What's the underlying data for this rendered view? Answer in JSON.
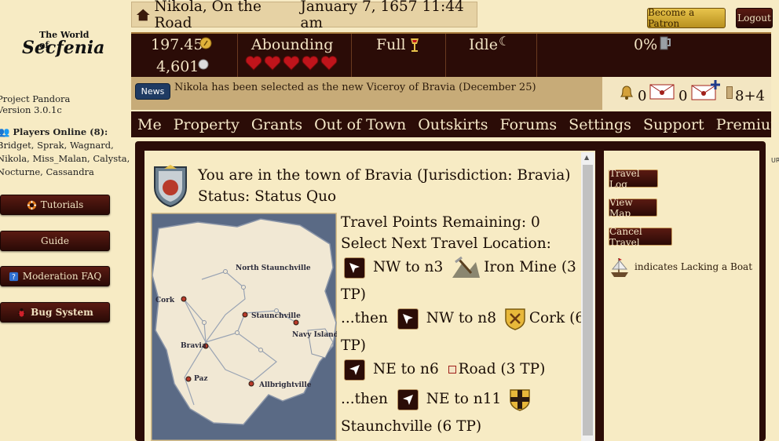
{
  "logo": {
    "line1": "The World of",
    "line2": "Secfenia"
  },
  "sidebar": {
    "project": "Project Pandora",
    "version": "Version 3.0.1c",
    "players_label": "Players Online (8):",
    "players_line1": "Bridget, Sprak, Wagnard,",
    "players_line2": "Nikola, Miss_Malan, Calysta,",
    "players_line3": "Nocturne, Cassandra",
    "buttons": [
      {
        "label": "Tutorials",
        "icon": "lifebuoy-icon"
      },
      {
        "label": "Guide",
        "icon": ""
      },
      {
        "label": "Moderation FAQ",
        "icon": "question-icon"
      },
      {
        "label": "Bug System",
        "icon": "bug-icon"
      }
    ]
  },
  "header": {
    "location": "Nikola, On the Road",
    "date": "January 7, 1657 11:44 am",
    "patron": "Become a Patron",
    "logout": "Logout"
  },
  "stats": {
    "money": "197.45",
    "silver": "4,601",
    "health_label": "Abounding",
    "hearts": 5,
    "food": "Full",
    "activity": "Idle",
    "drink": "0%"
  },
  "news": {
    "badge": "News",
    "text": "Nikola has been selected as the new Viceroy of Bravia (December 25)"
  },
  "notifications": {
    "bell": "0",
    "mail": "0",
    "new_mail": "",
    "counter": "8+4"
  },
  "nav": [
    "Me",
    "Property",
    "Grants",
    "Out of Town",
    "Outskirts",
    "Forums",
    "Settings",
    "Support",
    "Premium"
  ],
  "main": {
    "town_line": "You are in the town of Bravia (Jurisdiction: Bravia)",
    "status_line": "Status: Status Quo",
    "travel_points": "Travel Points Remaining: 0",
    "select_next": "Select Next Travel Location:",
    "options": [
      {
        "prefix": "",
        "dir": "NW to n3",
        "dest": "Iron Mine (3",
        "wrap": "TP)"
      },
      {
        "prefix": "...then",
        "dir": "NW to n8",
        "dest": "Cork (6",
        "wrap": "TP)"
      },
      {
        "prefix": "",
        "dir": "NE to n6",
        "dest": "Road (3 TP)",
        "wrap": ""
      },
      {
        "prefix": "...then",
        "dir": "NE to n11",
        "dest": "",
        "wrap": "Staunchville (6 TP)"
      }
    ]
  },
  "map_labels": [
    "North Staunchville",
    "Cork",
    "Staunchville",
    "Navy Island",
    "Bravia",
    "Paz",
    "Allbrightville"
  ],
  "right_panel": {
    "travel_log": "Travel Log",
    "view_map": "View Map",
    "cancel_travel": "Cancel Travel",
    "legend": "indicates Lacking a Boat"
  },
  "edge_text": "UR",
  "colors": {
    "parchment": "#f7ebc4",
    "dark": "#2b0c07",
    "news": "#1f3b63",
    "gold": "#e8c44c",
    "heart": "#c0141b"
  }
}
